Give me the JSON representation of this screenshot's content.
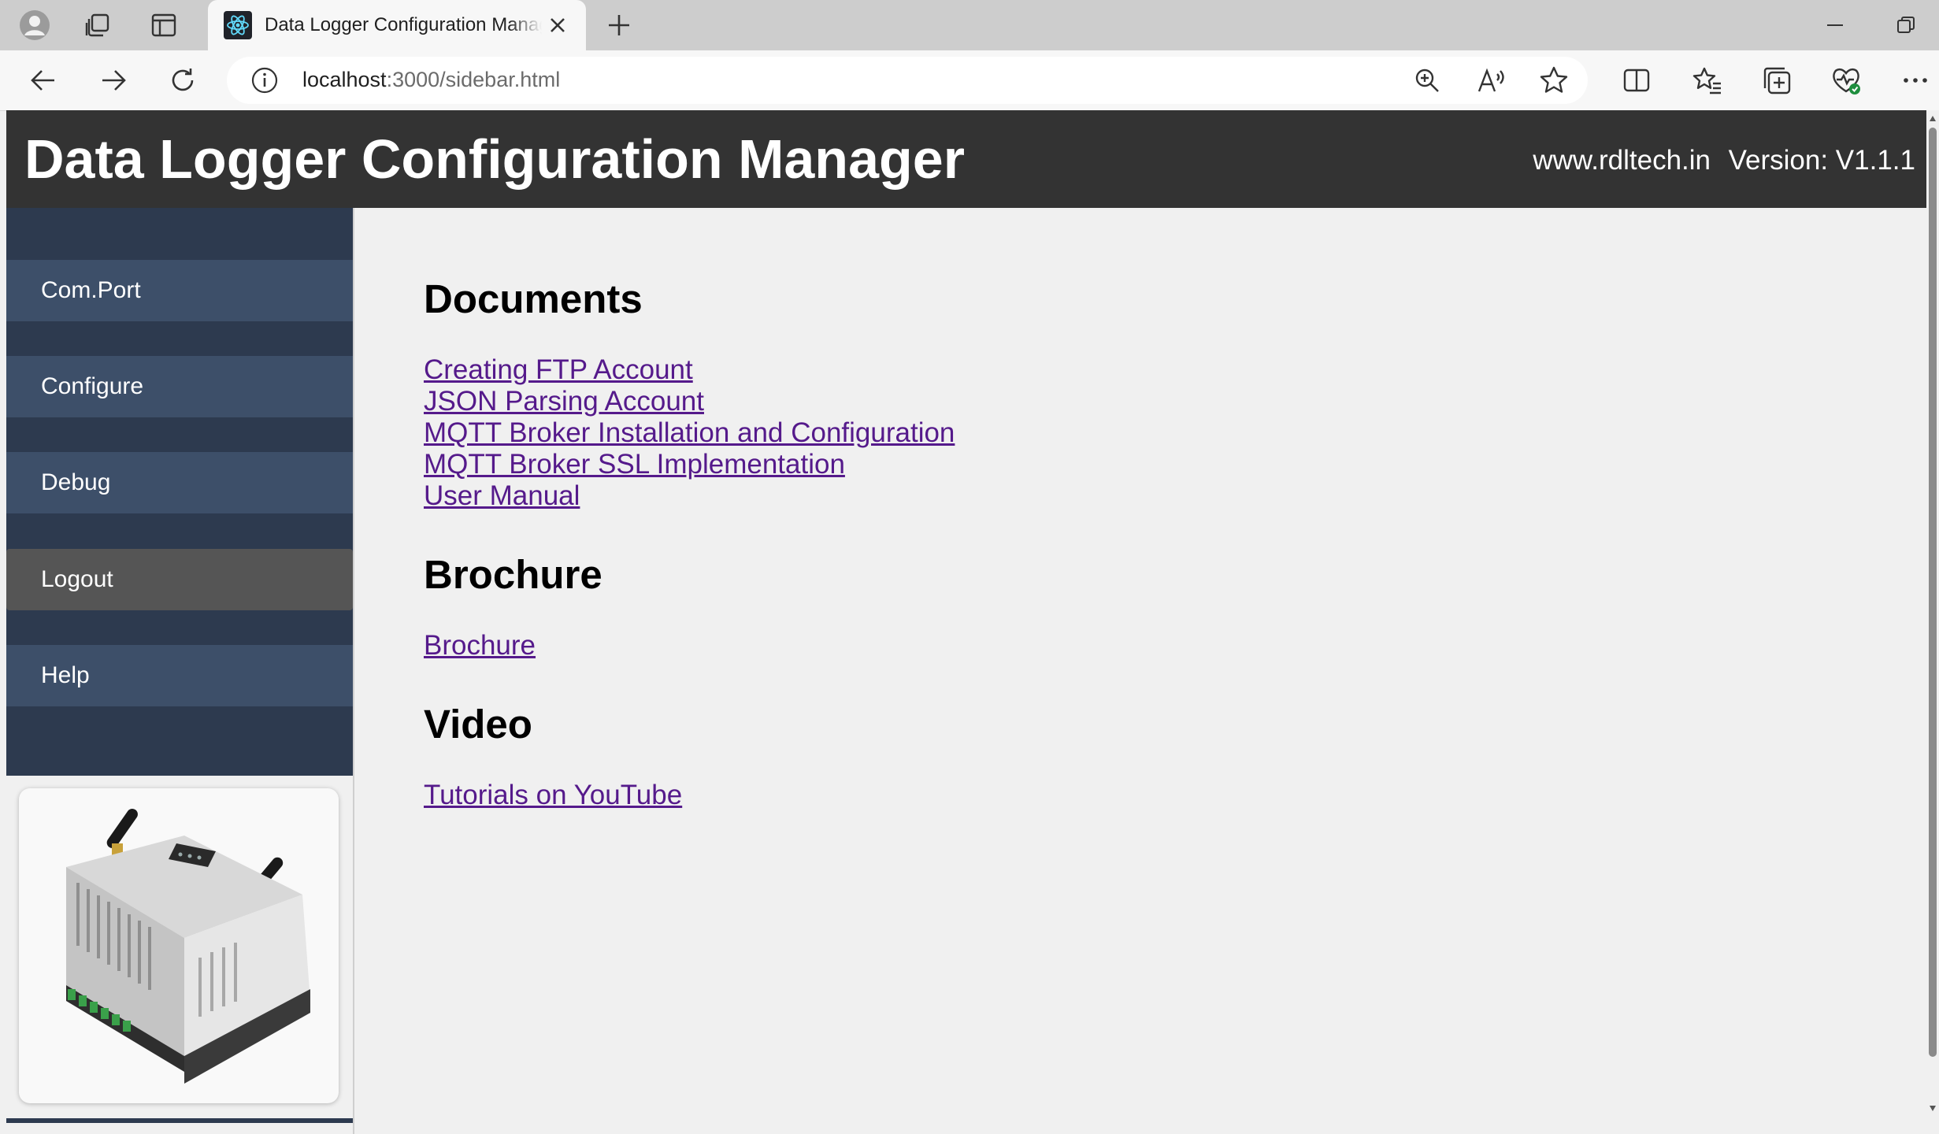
{
  "browser": {
    "tab_title": "Data Logger Configuration Manager",
    "url_host": "localhost",
    "url_path": ":3000/sidebar.html",
    "icons": [
      "profile-icon",
      "workspaces-icon",
      "vertical-tabs-icon",
      "react-favicon-icon",
      "close-icon",
      "new-tab-icon",
      "minimize-icon",
      "restore-icon",
      "back-icon",
      "forward-icon",
      "refresh-icon",
      "info-icon",
      "zoom-icon",
      "read-aloud-icon",
      "favorite-star-icon",
      "split-screen-icon",
      "favorites-icon",
      "collections-icon",
      "browser-essentials-icon",
      "more-icon"
    ]
  },
  "header": {
    "title": "Data Logger Configuration Manager",
    "site": "www.rdltech.in",
    "version": "Version: V1.1.1",
    "background": "#333333"
  },
  "sidebar": {
    "background": "#2d3a4f",
    "item_color": "#3d4f69",
    "active_color": "#555555",
    "items": [
      {
        "label": "Com.Port",
        "active": false
      },
      {
        "label": "Configure",
        "active": false
      },
      {
        "label": "Debug",
        "active": false
      },
      {
        "label": "Logout",
        "active": true
      },
      {
        "label": "Help",
        "active": false
      }
    ]
  },
  "content": {
    "documents": {
      "title": "Documents",
      "links": [
        "Creating FTP Account",
        "JSON Parsing Account",
        "MQTT Broker Installation and Configuration",
        "MQTT Broker SSL Implementation",
        "User Manual"
      ]
    },
    "brochure": {
      "title": "Brochure",
      "links": [
        "Brochure"
      ]
    },
    "video": {
      "title": "Video",
      "links": [
        "Tutorials on YouTube"
      ]
    },
    "link_color": "#551a8b"
  }
}
